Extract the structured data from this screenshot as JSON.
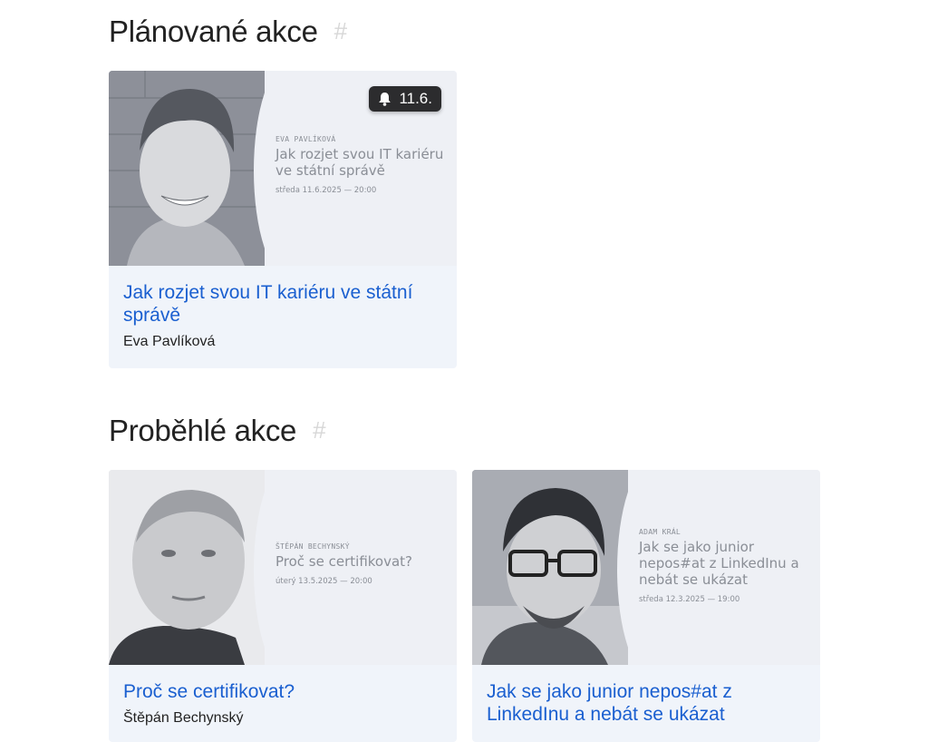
{
  "planned": {
    "heading": "Plánované akce",
    "anchor": "#",
    "events": [
      {
        "badge_icon": "bell-icon",
        "badge_date": "11.6.",
        "speaker_small": "EVA PAVLÍKOVÁ",
        "talk_small": "Jak rozjet svou IT kariéru ve státní správě",
        "date_small": "středa 11.6.2025 — 20:00",
        "title": "Jak rozjet svou IT kariéru ve státní správě",
        "speaker": "Eva Pavlíková"
      }
    ]
  },
  "past": {
    "heading": "Proběhlé akce",
    "anchor": "#",
    "events": [
      {
        "speaker_small": "ŠTĚPÁN BECHYNSKÝ",
        "talk_small": "Proč se certifikovat?",
        "date_small": "úterý 13.5.2025 — 20:00",
        "title": "Proč se certifikovat?",
        "speaker": "Štěpán Bechynský"
      },
      {
        "speaker_small": "ADAM KRÁL",
        "talk_small": "Jak se jako junior nepos#at z LinkedInu a nebát se ukázat",
        "date_small": "středa 12.3.2025 — 19:00",
        "title": "Jak se jako junior nepos#at z LinkedInu a nebát se ukázat",
        "speaker": ""
      }
    ]
  },
  "colors": {
    "link": "#1a5fd0",
    "card_bg": "#f0f4fa",
    "badge_bg": "#2c2c2e",
    "anchor": "#d7d7d7"
  }
}
